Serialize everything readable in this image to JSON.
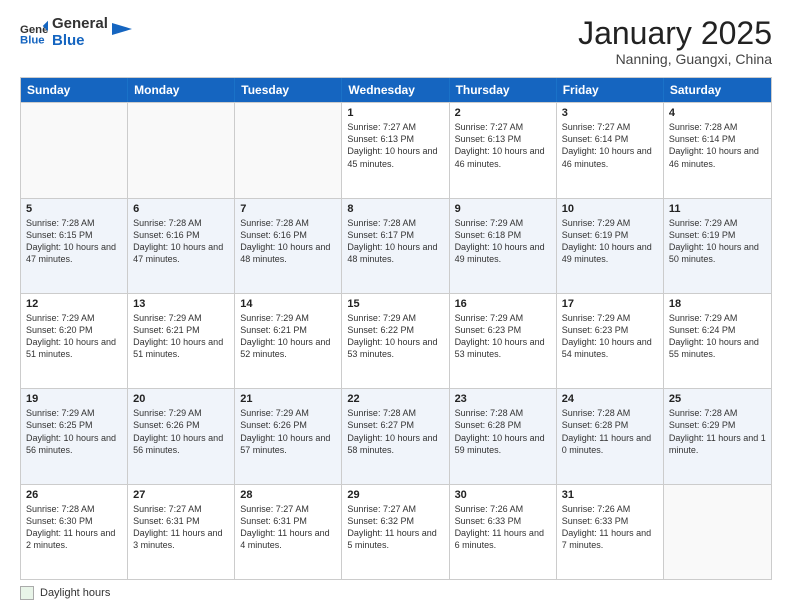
{
  "logo": {
    "general": "General",
    "blue": "Blue"
  },
  "header": {
    "month": "January 2025",
    "location": "Nanning, Guangxi, China"
  },
  "days": [
    "Sunday",
    "Monday",
    "Tuesday",
    "Wednesday",
    "Thursday",
    "Friday",
    "Saturday"
  ],
  "weeks": [
    [
      {
        "date": "",
        "sunrise": "",
        "sunset": "",
        "daylight": ""
      },
      {
        "date": "",
        "sunrise": "",
        "sunset": "",
        "daylight": ""
      },
      {
        "date": "",
        "sunrise": "",
        "sunset": "",
        "daylight": ""
      },
      {
        "date": "1",
        "sunrise": "Sunrise: 7:27 AM",
        "sunset": "Sunset: 6:13 PM",
        "daylight": "Daylight: 10 hours and 45 minutes."
      },
      {
        "date": "2",
        "sunrise": "Sunrise: 7:27 AM",
        "sunset": "Sunset: 6:13 PM",
        "daylight": "Daylight: 10 hours and 46 minutes."
      },
      {
        "date": "3",
        "sunrise": "Sunrise: 7:27 AM",
        "sunset": "Sunset: 6:14 PM",
        "daylight": "Daylight: 10 hours and 46 minutes."
      },
      {
        "date": "4",
        "sunrise": "Sunrise: 7:28 AM",
        "sunset": "Sunset: 6:14 PM",
        "daylight": "Daylight: 10 hours and 46 minutes."
      }
    ],
    [
      {
        "date": "5",
        "sunrise": "Sunrise: 7:28 AM",
        "sunset": "Sunset: 6:15 PM",
        "daylight": "Daylight: 10 hours and 47 minutes."
      },
      {
        "date": "6",
        "sunrise": "Sunrise: 7:28 AM",
        "sunset": "Sunset: 6:16 PM",
        "daylight": "Daylight: 10 hours and 47 minutes."
      },
      {
        "date": "7",
        "sunrise": "Sunrise: 7:28 AM",
        "sunset": "Sunset: 6:16 PM",
        "daylight": "Daylight: 10 hours and 48 minutes."
      },
      {
        "date": "8",
        "sunrise": "Sunrise: 7:28 AM",
        "sunset": "Sunset: 6:17 PM",
        "daylight": "Daylight: 10 hours and 48 minutes."
      },
      {
        "date": "9",
        "sunrise": "Sunrise: 7:29 AM",
        "sunset": "Sunset: 6:18 PM",
        "daylight": "Daylight: 10 hours and 49 minutes."
      },
      {
        "date": "10",
        "sunrise": "Sunrise: 7:29 AM",
        "sunset": "Sunset: 6:19 PM",
        "daylight": "Daylight: 10 hours and 49 minutes."
      },
      {
        "date": "11",
        "sunrise": "Sunrise: 7:29 AM",
        "sunset": "Sunset: 6:19 PM",
        "daylight": "Daylight: 10 hours and 50 minutes."
      }
    ],
    [
      {
        "date": "12",
        "sunrise": "Sunrise: 7:29 AM",
        "sunset": "Sunset: 6:20 PM",
        "daylight": "Daylight: 10 hours and 51 minutes."
      },
      {
        "date": "13",
        "sunrise": "Sunrise: 7:29 AM",
        "sunset": "Sunset: 6:21 PM",
        "daylight": "Daylight: 10 hours and 51 minutes."
      },
      {
        "date": "14",
        "sunrise": "Sunrise: 7:29 AM",
        "sunset": "Sunset: 6:21 PM",
        "daylight": "Daylight: 10 hours and 52 minutes."
      },
      {
        "date": "15",
        "sunrise": "Sunrise: 7:29 AM",
        "sunset": "Sunset: 6:22 PM",
        "daylight": "Daylight: 10 hours and 53 minutes."
      },
      {
        "date": "16",
        "sunrise": "Sunrise: 7:29 AM",
        "sunset": "Sunset: 6:23 PM",
        "daylight": "Daylight: 10 hours and 53 minutes."
      },
      {
        "date": "17",
        "sunrise": "Sunrise: 7:29 AM",
        "sunset": "Sunset: 6:23 PM",
        "daylight": "Daylight: 10 hours and 54 minutes."
      },
      {
        "date": "18",
        "sunrise": "Sunrise: 7:29 AM",
        "sunset": "Sunset: 6:24 PM",
        "daylight": "Daylight: 10 hours and 55 minutes."
      }
    ],
    [
      {
        "date": "19",
        "sunrise": "Sunrise: 7:29 AM",
        "sunset": "Sunset: 6:25 PM",
        "daylight": "Daylight: 10 hours and 56 minutes."
      },
      {
        "date": "20",
        "sunrise": "Sunrise: 7:29 AM",
        "sunset": "Sunset: 6:26 PM",
        "daylight": "Daylight: 10 hours and 56 minutes."
      },
      {
        "date": "21",
        "sunrise": "Sunrise: 7:29 AM",
        "sunset": "Sunset: 6:26 PM",
        "daylight": "Daylight: 10 hours and 57 minutes."
      },
      {
        "date": "22",
        "sunrise": "Sunrise: 7:28 AM",
        "sunset": "Sunset: 6:27 PM",
        "daylight": "Daylight: 10 hours and 58 minutes."
      },
      {
        "date": "23",
        "sunrise": "Sunrise: 7:28 AM",
        "sunset": "Sunset: 6:28 PM",
        "daylight": "Daylight: 10 hours and 59 minutes."
      },
      {
        "date": "24",
        "sunrise": "Sunrise: 7:28 AM",
        "sunset": "Sunset: 6:28 PM",
        "daylight": "Daylight: 11 hours and 0 minutes."
      },
      {
        "date": "25",
        "sunrise": "Sunrise: 7:28 AM",
        "sunset": "Sunset: 6:29 PM",
        "daylight": "Daylight: 11 hours and 1 minute."
      }
    ],
    [
      {
        "date": "26",
        "sunrise": "Sunrise: 7:28 AM",
        "sunset": "Sunset: 6:30 PM",
        "daylight": "Daylight: 11 hours and 2 minutes."
      },
      {
        "date": "27",
        "sunrise": "Sunrise: 7:27 AM",
        "sunset": "Sunset: 6:31 PM",
        "daylight": "Daylight: 11 hours and 3 minutes."
      },
      {
        "date": "28",
        "sunrise": "Sunrise: 7:27 AM",
        "sunset": "Sunset: 6:31 PM",
        "daylight": "Daylight: 11 hours and 4 minutes."
      },
      {
        "date": "29",
        "sunrise": "Sunrise: 7:27 AM",
        "sunset": "Sunset: 6:32 PM",
        "daylight": "Daylight: 11 hours and 5 minutes."
      },
      {
        "date": "30",
        "sunrise": "Sunrise: 7:26 AM",
        "sunset": "Sunset: 6:33 PM",
        "daylight": "Daylight: 11 hours and 6 minutes."
      },
      {
        "date": "31",
        "sunrise": "Sunrise: 7:26 AM",
        "sunset": "Sunset: 6:33 PM",
        "daylight": "Daylight: 11 hours and 7 minutes."
      },
      {
        "date": "",
        "sunrise": "",
        "sunset": "",
        "daylight": ""
      }
    ]
  ],
  "footer": {
    "legend_label": "Daylight hours"
  }
}
